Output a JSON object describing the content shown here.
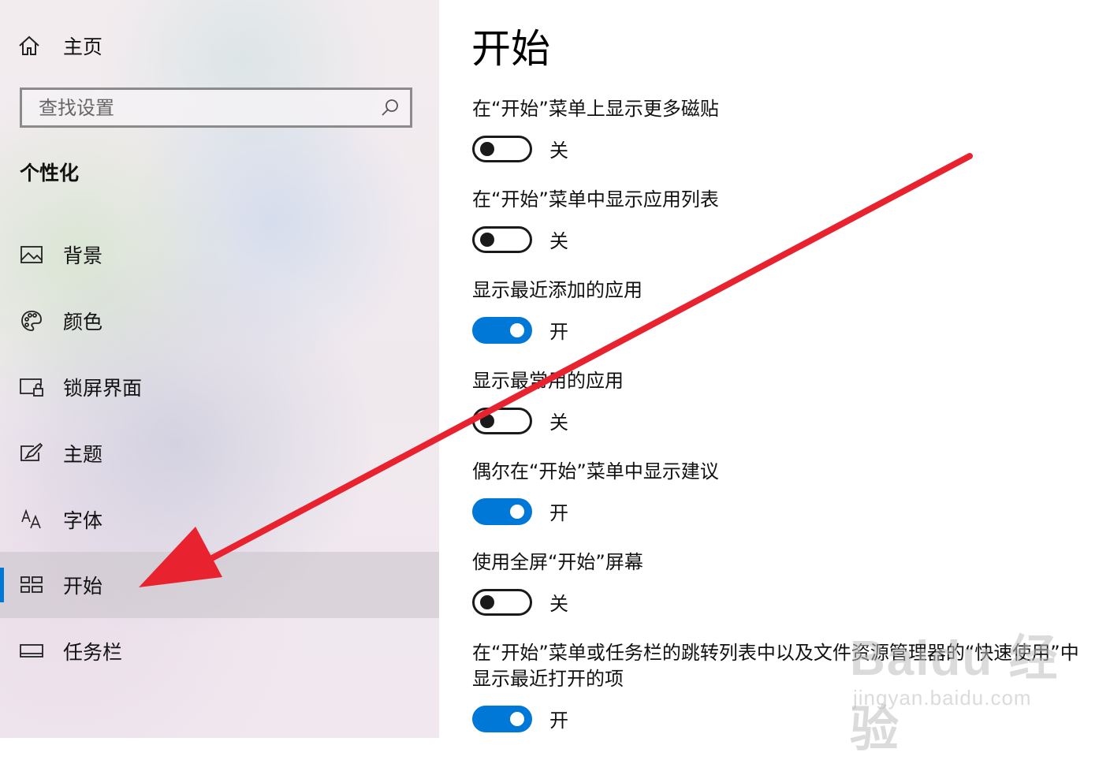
{
  "sidebar": {
    "home_label": "主页",
    "search_placeholder": "查找设置",
    "section_title": "个性化",
    "items": [
      {
        "label": "背景",
        "icon": "picture-icon"
      },
      {
        "label": "颜色",
        "icon": "palette-icon"
      },
      {
        "label": "锁屏界面",
        "icon": "lock-screen-icon"
      },
      {
        "label": "主题",
        "icon": "theme-brush-icon"
      },
      {
        "label": "字体",
        "icon": "font-icon"
      },
      {
        "label": "开始",
        "icon": "start-grid-icon",
        "selected": true
      },
      {
        "label": "任务栏",
        "icon": "taskbar-icon"
      }
    ]
  },
  "main": {
    "title": "开始",
    "settings": [
      {
        "label": "在“开始”菜单上显示更多磁贴",
        "on": false,
        "state": "关"
      },
      {
        "label": "在“开始”菜单中显示应用列表",
        "on": false,
        "state": "关"
      },
      {
        "label": "显示最近添加的应用",
        "on": true,
        "state": "开"
      },
      {
        "label": "显示最常用的应用",
        "on": false,
        "state": "关"
      },
      {
        "label": "偶尔在“开始”菜单中显示建议",
        "on": true,
        "state": "开"
      },
      {
        "label": "使用全屏“开始”屏幕",
        "on": false,
        "state": "关"
      },
      {
        "label": "在“开始”菜单或任务栏的跳转列表中以及文件资源管理器的“快速使用”中显示最近打开的项",
        "on": true,
        "state": "开"
      }
    ]
  },
  "watermark": {
    "brand": "Baidu 经验",
    "url": "jingyan.baidu.com"
  },
  "colors": {
    "accent": "#0078d7",
    "annotation_arrow": "#e8232f"
  }
}
